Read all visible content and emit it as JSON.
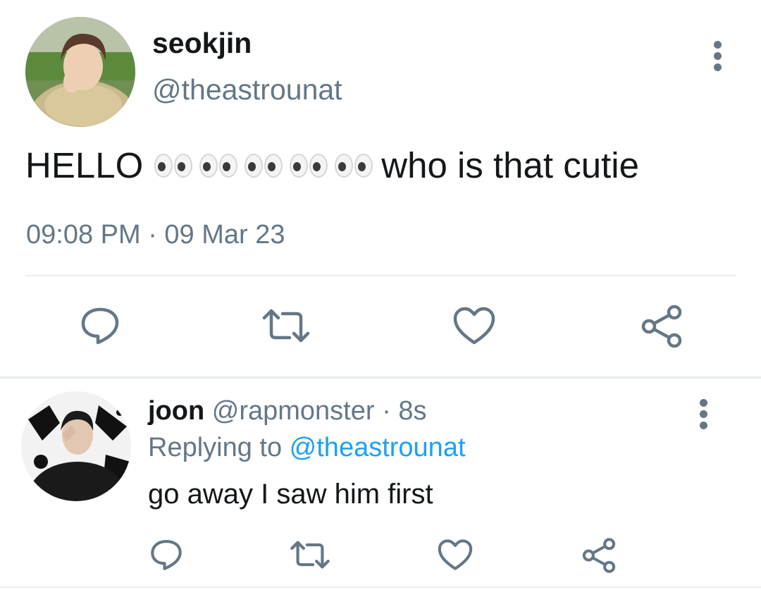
{
  "main_tweet": {
    "display_name": "seokjin",
    "handle": "@theastrounat",
    "text_before": "HELLO",
    "emoji_name": "eyes-emoji",
    "emoji_count": 5,
    "text_after": "who is that cutie",
    "timestamp": "09:08 PM · 09 Mar 23",
    "actions": [
      "reply-icon",
      "retweet-icon",
      "like-icon",
      "share-icon"
    ]
  },
  "reply_tweet": {
    "display_name": "joon",
    "handle": "@rapmonster",
    "separator": " · ",
    "time": "8s",
    "replying_prefix": "Replying to ",
    "replying_to": "@theastrounat",
    "text": "go away I saw him first",
    "actions": [
      "reply-icon",
      "retweet-icon",
      "like-icon",
      "share-icon"
    ]
  },
  "colors": {
    "text": "#14171a",
    "secondary": "#657786",
    "accent": "#1da1f2",
    "divider": "#e6ecf0"
  }
}
